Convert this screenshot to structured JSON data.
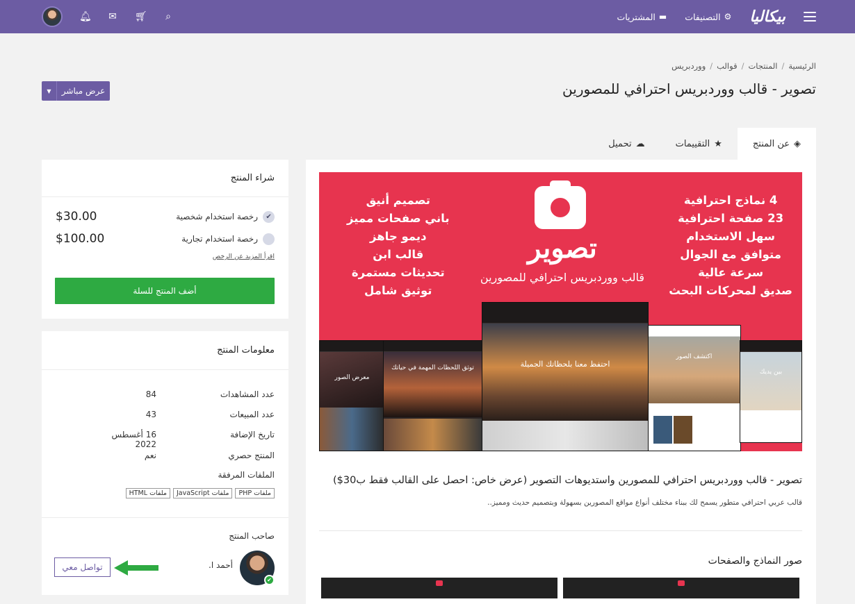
{
  "nav": {
    "logo": "بيكاليا",
    "categories": "التصنيفات",
    "purchases": "المشتريات"
  },
  "breadcrumb": [
    "الرئيسية",
    "المنتجات",
    "قوالب",
    "ووردبريس"
  ],
  "title": "تصوير - قالب ووردبريس احترافي للمصورين",
  "live_button": "عرض مباشر",
  "tabs": [
    {
      "label": "عن المنتج",
      "icon": "cube-icon",
      "active": true
    },
    {
      "label": "التقييمات",
      "icon": "star-icon",
      "active": false
    },
    {
      "label": "تحميل",
      "icon": "cloud-download-icon",
      "active": false
    }
  ],
  "banner": {
    "right_features": [
      "4 نماذج احترافية",
      "23 صفحة احترافية",
      "سهل الاستخدام",
      "متوافق مع الجوال",
      "سرعة عالية",
      "صديق لمحركات البحث"
    ],
    "left_features": [
      "تصميم أنيق",
      "باني صفحات مميز",
      "ديمو جاهز",
      "قالب ابن",
      "تحديثات مستمرة",
      "توثيق شامل"
    ],
    "brand": "تصوير",
    "subtitle": "قالب ووردبريس احترافي للمصورين",
    "shot_captions": [
      "احتفظ معنا بلحظاتك الجميلة",
      "توثق اللحظات المهمة في حياتك",
      "معرض الصور",
      "اكتشف الصور",
      "بين يديك"
    ]
  },
  "product": {
    "heading": "تصوير - قالب ووردبريس احترافي للمصورين واستديوهات التصوير (عرض خاص: احصل على القالب فقط ب30$)",
    "description": "قالب عربي احترافي متطور يسمح لك ببناء مختلف أنواع مواقع المصورين بسهولة وبتصميم حديث ومميز..",
    "gallery_title": "صور النماذج والصفحات"
  },
  "purchase": {
    "title": "شراء المنتج",
    "licenses": [
      {
        "label": "رخصة استخدام شخصية",
        "price": "$30.00",
        "selected": true
      },
      {
        "label": "رخصة استخدام تجارية",
        "price": "$100.00",
        "selected": false
      }
    ],
    "more_link": "اقرأ المزيد عن الرخص",
    "add_to_cart": "أضف المنتج للسلة"
  },
  "info": {
    "title": "معلومات المنتج",
    "rows": [
      {
        "key": "عدد المشاهدات",
        "value": "84"
      },
      {
        "key": "عدد المبيعات",
        "value": "43"
      },
      {
        "key": "تاريخ الإضافة",
        "value": "16 أغسطس 2022"
      },
      {
        "key": "المنتج حصري",
        "value": "نعم"
      }
    ],
    "files_label": "الملفات المرفقة",
    "files": [
      "ملفات PHP",
      "ملفات JavaScript",
      "ملفات HTML"
    ],
    "owner_label": "صاحب المنتج",
    "owner_name": "أحمد ا.",
    "contact_button": "تواصل معي"
  },
  "colors": {
    "brand": "#6c5ca3",
    "banner": "#e7344f",
    "cart": "#2eaa42"
  }
}
